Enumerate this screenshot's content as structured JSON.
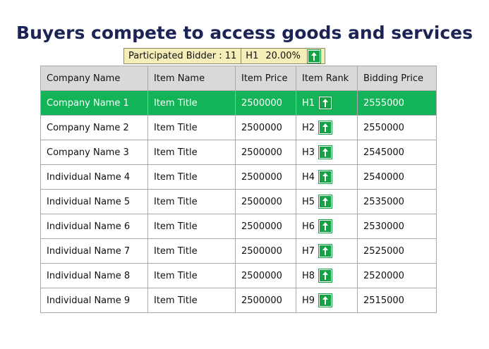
{
  "page": {
    "title": "Buyers compete to access goods and services"
  },
  "info_bar": {
    "participated": "Participated Bidder : 11",
    "top_rank": "H1",
    "percent": "20.00%",
    "arrow_icon": "arrow-up-icon"
  },
  "table": {
    "headers": [
      "Company Name",
      "Item Name",
      "Item Price",
      "Item Rank",
      "Bidding Price"
    ],
    "selected_row_color": "#12b457",
    "rows": [
      {
        "company": "Company Name 1",
        "item": "Item Title",
        "price": "2500000",
        "rank": "H1",
        "bid": "2555000"
      },
      {
        "company": "Company Name 2",
        "item": "Item Title",
        "price": "2500000",
        "rank": "H2",
        "bid": "2550000"
      },
      {
        "company": "Company Name 3",
        "item": "Item Title",
        "price": "2500000",
        "rank": "H3",
        "bid": "2545000"
      },
      {
        "company": "Individual Name 4",
        "item": "Item Title",
        "price": "2500000",
        "rank": "H4",
        "bid": "2540000"
      },
      {
        "company": "Individual Name 5",
        "item": "Item Title",
        "price": "2500000",
        "rank": "H5",
        "bid": "2535000"
      },
      {
        "company": "Individual Name 6",
        "item": "Item Title",
        "price": "2500000",
        "rank": "H6",
        "bid": "2530000"
      },
      {
        "company": "Individual Name 7",
        "item": "Item Title",
        "price": "2500000",
        "rank": "H7",
        "bid": "2525000"
      },
      {
        "company": "Individual Name 8",
        "item": "Item Title",
        "price": "2500000",
        "rank": "H8",
        "bid": "2520000"
      },
      {
        "company": "Individual Name 9",
        "item": "Item Title",
        "price": "2500000",
        "rank": "H9",
        "bid": "2515000"
      }
    ]
  }
}
